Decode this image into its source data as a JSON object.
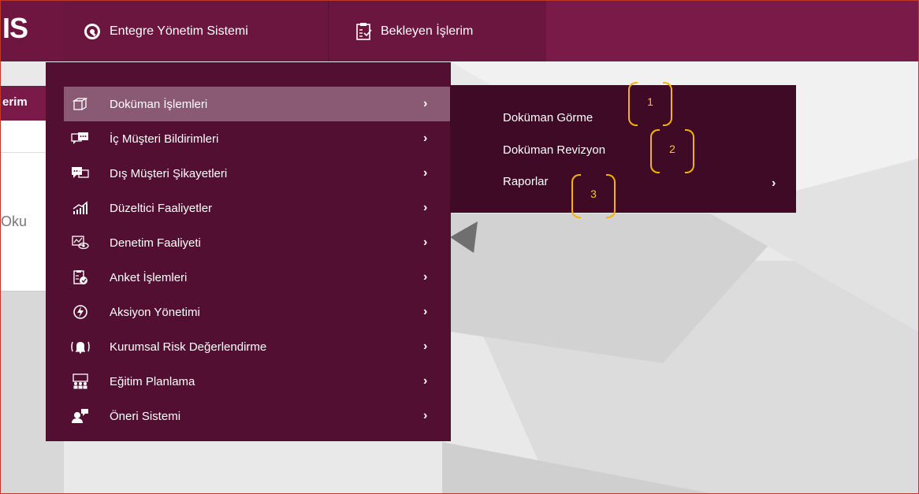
{
  "app": {
    "logo_text": "IS"
  },
  "topnav": {
    "items": [
      {
        "label": "Entegre Yönetim Sistemi",
        "icon": "circle-q-icon"
      },
      {
        "label": "Bekleyen İşlerim",
        "icon": "clipboard-check-icon"
      }
    ]
  },
  "background": {
    "tab_fragment": "erim",
    "text_fragment": "Oku"
  },
  "menu": {
    "items": [
      {
        "label": "Doküman İşlemleri",
        "icon": "box-icon",
        "chevron": "›"
      },
      {
        "label": "İç Müşteri Bildirimleri",
        "icon": "chat-icon",
        "chevron": "›"
      },
      {
        "label": "Dış Müşteri Şikayetleri",
        "icon": "chat-reply-icon",
        "chevron": "›"
      },
      {
        "label": "Düzeltici Faaliyetler",
        "icon": "chart-up-icon",
        "chevron": "›"
      },
      {
        "label": "Denetim Faaliyeti",
        "icon": "audit-eye-icon",
        "chevron": "›"
      },
      {
        "label": "Anket İşlemleri",
        "icon": "survey-icon",
        "chevron": "›"
      },
      {
        "label": "Aksiyon Yönetimi",
        "icon": "lightning-icon",
        "chevron": "›"
      },
      {
        "label": "Kurumsal Risk Değerlendirme",
        "icon": "alarm-bell-icon",
        "chevron": "›"
      },
      {
        "label": "Eğitim Planlama",
        "icon": "training-icon",
        "chevron": "›"
      },
      {
        "label": "Öneri Sistemi",
        "icon": "suggestion-icon",
        "chevron": "›"
      }
    ]
  },
  "submenu": {
    "items": [
      {
        "label": "Doküman Görme"
      },
      {
        "label": "Doküman Revizyon"
      },
      {
        "label": "Raporlar",
        "chevron": "›"
      }
    ]
  },
  "annotations": [
    "1",
    "2",
    "3"
  ],
  "colors": {
    "topbar": "#7a1a48",
    "menu": "#530f31",
    "submenu": "#3e0a25",
    "annotation": "#f4b400"
  }
}
